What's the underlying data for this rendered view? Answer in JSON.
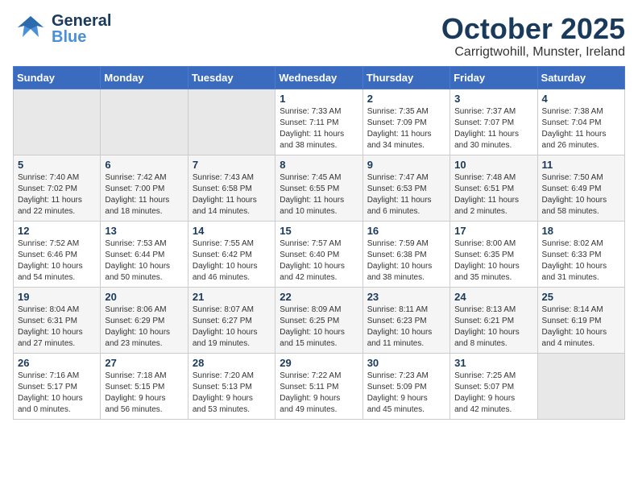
{
  "logo": {
    "general": "General",
    "blue": "Blue"
  },
  "header": {
    "month": "October 2025",
    "location": "Carrigtwohill, Munster, Ireland"
  },
  "days_of_week": [
    "Sunday",
    "Monday",
    "Tuesday",
    "Wednesday",
    "Thursday",
    "Friday",
    "Saturday"
  ],
  "weeks": [
    [
      {
        "day": "",
        "info": ""
      },
      {
        "day": "",
        "info": ""
      },
      {
        "day": "",
        "info": ""
      },
      {
        "day": "1",
        "info": "Sunrise: 7:33 AM\nSunset: 7:11 PM\nDaylight: 11 hours\nand 38 minutes."
      },
      {
        "day": "2",
        "info": "Sunrise: 7:35 AM\nSunset: 7:09 PM\nDaylight: 11 hours\nand 34 minutes."
      },
      {
        "day": "3",
        "info": "Sunrise: 7:37 AM\nSunset: 7:07 PM\nDaylight: 11 hours\nand 30 minutes."
      },
      {
        "day": "4",
        "info": "Sunrise: 7:38 AM\nSunset: 7:04 PM\nDaylight: 11 hours\nand 26 minutes."
      }
    ],
    [
      {
        "day": "5",
        "info": "Sunrise: 7:40 AM\nSunset: 7:02 PM\nDaylight: 11 hours\nand 22 minutes."
      },
      {
        "day": "6",
        "info": "Sunrise: 7:42 AM\nSunset: 7:00 PM\nDaylight: 11 hours\nand 18 minutes."
      },
      {
        "day": "7",
        "info": "Sunrise: 7:43 AM\nSunset: 6:58 PM\nDaylight: 11 hours\nand 14 minutes."
      },
      {
        "day": "8",
        "info": "Sunrise: 7:45 AM\nSunset: 6:55 PM\nDaylight: 11 hours\nand 10 minutes."
      },
      {
        "day": "9",
        "info": "Sunrise: 7:47 AM\nSunset: 6:53 PM\nDaylight: 11 hours\nand 6 minutes."
      },
      {
        "day": "10",
        "info": "Sunrise: 7:48 AM\nSunset: 6:51 PM\nDaylight: 11 hours\nand 2 minutes."
      },
      {
        "day": "11",
        "info": "Sunrise: 7:50 AM\nSunset: 6:49 PM\nDaylight: 10 hours\nand 58 minutes."
      }
    ],
    [
      {
        "day": "12",
        "info": "Sunrise: 7:52 AM\nSunset: 6:46 PM\nDaylight: 10 hours\nand 54 minutes."
      },
      {
        "day": "13",
        "info": "Sunrise: 7:53 AM\nSunset: 6:44 PM\nDaylight: 10 hours\nand 50 minutes."
      },
      {
        "day": "14",
        "info": "Sunrise: 7:55 AM\nSunset: 6:42 PM\nDaylight: 10 hours\nand 46 minutes."
      },
      {
        "day": "15",
        "info": "Sunrise: 7:57 AM\nSunset: 6:40 PM\nDaylight: 10 hours\nand 42 minutes."
      },
      {
        "day": "16",
        "info": "Sunrise: 7:59 AM\nSunset: 6:38 PM\nDaylight: 10 hours\nand 38 minutes."
      },
      {
        "day": "17",
        "info": "Sunrise: 8:00 AM\nSunset: 6:35 PM\nDaylight: 10 hours\nand 35 minutes."
      },
      {
        "day": "18",
        "info": "Sunrise: 8:02 AM\nSunset: 6:33 PM\nDaylight: 10 hours\nand 31 minutes."
      }
    ],
    [
      {
        "day": "19",
        "info": "Sunrise: 8:04 AM\nSunset: 6:31 PM\nDaylight: 10 hours\nand 27 minutes."
      },
      {
        "day": "20",
        "info": "Sunrise: 8:06 AM\nSunset: 6:29 PM\nDaylight: 10 hours\nand 23 minutes."
      },
      {
        "day": "21",
        "info": "Sunrise: 8:07 AM\nSunset: 6:27 PM\nDaylight: 10 hours\nand 19 minutes."
      },
      {
        "day": "22",
        "info": "Sunrise: 8:09 AM\nSunset: 6:25 PM\nDaylight: 10 hours\nand 15 minutes."
      },
      {
        "day": "23",
        "info": "Sunrise: 8:11 AM\nSunset: 6:23 PM\nDaylight: 10 hours\nand 11 minutes."
      },
      {
        "day": "24",
        "info": "Sunrise: 8:13 AM\nSunset: 6:21 PM\nDaylight: 10 hours\nand 8 minutes."
      },
      {
        "day": "25",
        "info": "Sunrise: 8:14 AM\nSunset: 6:19 PM\nDaylight: 10 hours\nand 4 minutes."
      }
    ],
    [
      {
        "day": "26",
        "info": "Sunrise: 7:16 AM\nSunset: 5:17 PM\nDaylight: 10 hours\nand 0 minutes."
      },
      {
        "day": "27",
        "info": "Sunrise: 7:18 AM\nSunset: 5:15 PM\nDaylight: 9 hours\nand 56 minutes."
      },
      {
        "day": "28",
        "info": "Sunrise: 7:20 AM\nSunset: 5:13 PM\nDaylight: 9 hours\nand 53 minutes."
      },
      {
        "day": "29",
        "info": "Sunrise: 7:22 AM\nSunset: 5:11 PM\nDaylight: 9 hours\nand 49 minutes."
      },
      {
        "day": "30",
        "info": "Sunrise: 7:23 AM\nSunset: 5:09 PM\nDaylight: 9 hours\nand 45 minutes."
      },
      {
        "day": "31",
        "info": "Sunrise: 7:25 AM\nSunset: 5:07 PM\nDaylight: 9 hours\nand 42 minutes."
      },
      {
        "day": "",
        "info": ""
      }
    ]
  ]
}
